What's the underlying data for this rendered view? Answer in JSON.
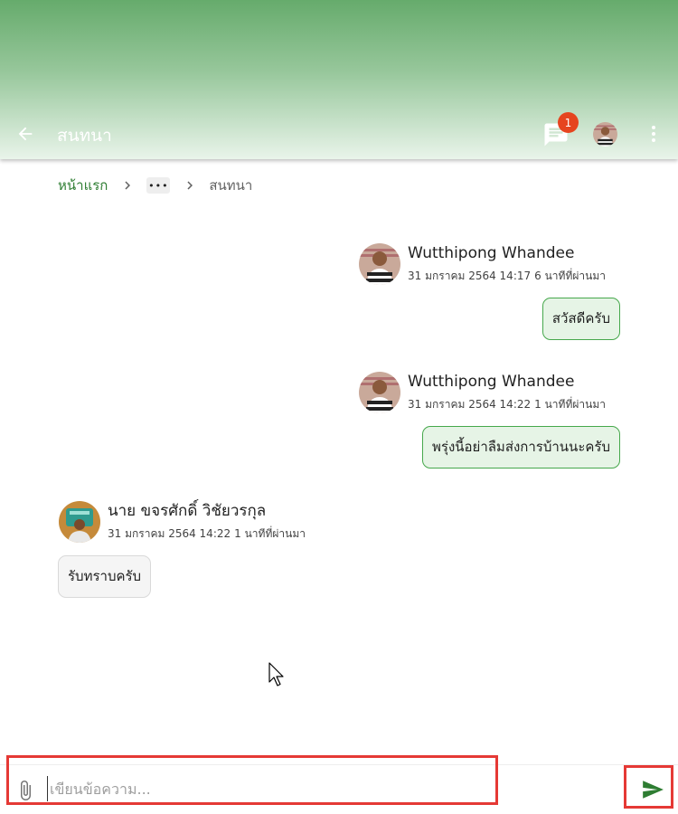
{
  "app_bar": {
    "title": "สนทนา",
    "notification_count": "1",
    "back_icon": "arrow-left-icon",
    "chat_icon": "chat-bubble-icon",
    "more_icon": "more-vertical-icon"
  },
  "breadcrumb": {
    "home": "หน้าแรก",
    "ellipsis": "•••",
    "current": "สนทนา"
  },
  "messages": [
    {
      "sender": "Wutthipong Whandee",
      "date": "31 มกราคม 2564 14:17",
      "relative": "6 นาทีที่ผ่านมา",
      "text": "สวัสดีครับ",
      "side": "right"
    },
    {
      "sender": "Wutthipong Whandee",
      "date": "31 มกราคม 2564 14:22",
      "relative": "1 นาทีที่ผ่านมา",
      "text": "พรุ่งนี้อย่าลืมส่งการบ้านนะครับ",
      "side": "right"
    },
    {
      "sender": "นาย ขจรศักดิ์ วิชัยวรกุล",
      "date": "31 มกราคม 2564 14:22",
      "relative": "1 นาทีที่ผ่านมา",
      "text": "รับทราบครับ",
      "side": "left"
    }
  ],
  "composer": {
    "placeholder": "เขียนข้อความ...",
    "value": "",
    "attach_icon": "paperclip-icon",
    "send_icon": "send-icon"
  },
  "colors": {
    "app_bar_top": "#66ab6c",
    "accent": "#2e7d32",
    "badge": "#e6451f",
    "bubble_mine_bg": "#e6f4e6",
    "bubble_mine_border": "#46a84c",
    "send": "#2e7d32",
    "highlight": "#e53935"
  }
}
